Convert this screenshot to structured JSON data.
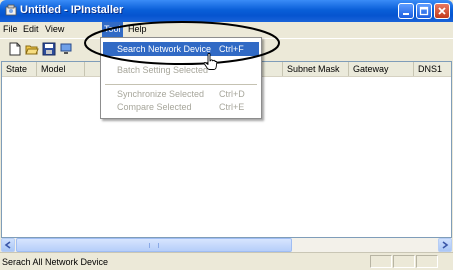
{
  "window": {
    "title": "Untitled - IPInstaller"
  },
  "menubar": {
    "items": [
      "File",
      "Edit",
      "View",
      "Tool",
      "Help"
    ]
  },
  "toolbar": {
    "icons": [
      "new-file-icon",
      "open-folder-icon",
      "save-icon",
      "network-icon"
    ]
  },
  "listview": {
    "columns": [
      "State",
      "Model",
      "",
      "",
      "",
      "Subnet Mask",
      "Gateway",
      "DNS1"
    ]
  },
  "tool_menu": {
    "items": [
      {
        "label": "Search Network Device",
        "shortcut": "Ctrl+F",
        "state": "highlighted"
      },
      {
        "label": "Batch Setting Selected",
        "shortcut": "",
        "state": "disabled"
      },
      {
        "label": "Synchronize Selected",
        "shortcut": "Ctrl+D",
        "state": "disabled"
      },
      {
        "label": "Compare Selected",
        "shortcut": "Ctrl+E",
        "state": "disabled"
      }
    ]
  },
  "statusbar": {
    "text": "Serach All Network Device"
  },
  "colors": {
    "highlight": "#316ac5",
    "annotation": "#000000",
    "titlebar": "#0a5fd8"
  }
}
